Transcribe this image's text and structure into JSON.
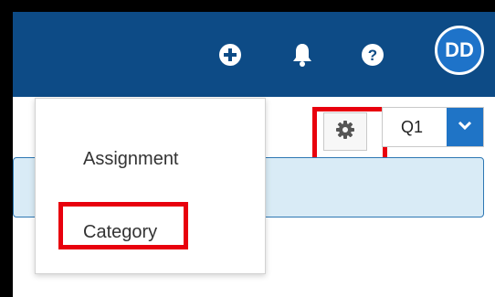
{
  "header": {
    "icons": [
      "add-circle-icon",
      "bell-icon",
      "help-icon"
    ],
    "avatar_initials": "DD"
  },
  "toolbar": {
    "settings_icon": "gear-icon",
    "quarter_value": "Q1"
  },
  "menu": {
    "items": [
      {
        "label": "Assignment"
      },
      {
        "label": "Category"
      }
    ]
  },
  "colors": {
    "header_bg": "#0d4b86",
    "accent": "#1f74c6",
    "highlight": "#e8000d",
    "info_bg": "#d9ebf6"
  }
}
